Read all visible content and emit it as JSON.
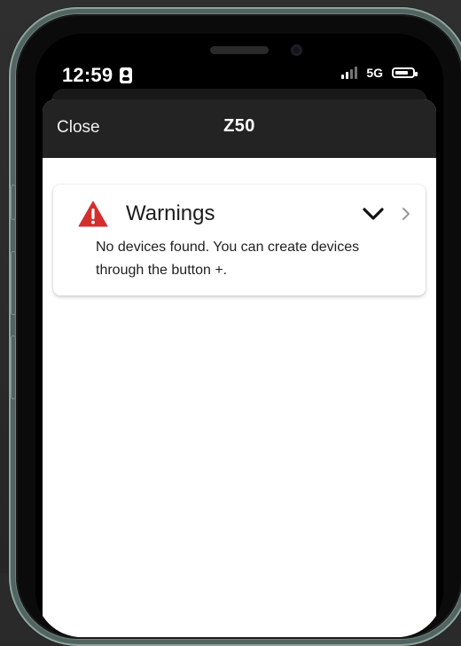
{
  "status_bar": {
    "time": "12:59",
    "network": "5G"
  },
  "modal": {
    "close_label": "Close",
    "title": "Z50"
  },
  "warnings_card": {
    "title": "Warnings",
    "message": "No devices found. You can create devices through the button +."
  },
  "colors": {
    "warning_red": "#d32f2f",
    "header_bg": "#232323",
    "frame_green": "#6f8780"
  },
  "icons": {
    "status_id": "person-badge-icon",
    "signal": "cellular-signal-icon",
    "battery": "battery-icon",
    "warning": "warning-triangle-icon",
    "expand": "chevron-down-icon",
    "navigate": "chevron-right-icon"
  }
}
